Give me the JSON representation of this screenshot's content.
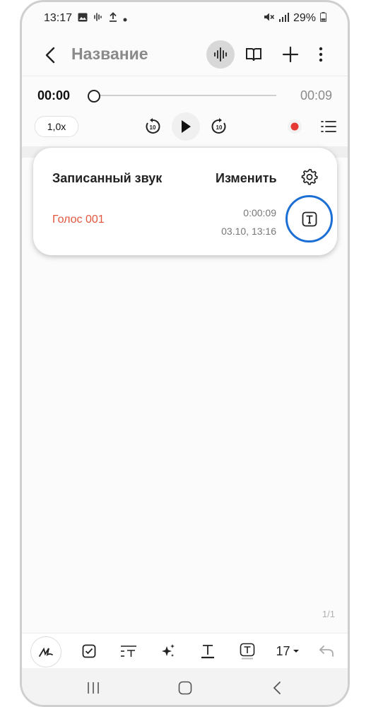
{
  "status": {
    "time": "13:17",
    "battery": "29%"
  },
  "appbar": {
    "title": "Название"
  },
  "player": {
    "current_time": "00:00",
    "total_time": "00:09",
    "progress": 0,
    "speed": "1,0x",
    "rewind_seconds": "10",
    "forward_seconds": "10"
  },
  "card": {
    "title": "Записанный звук",
    "edit_label": "Изменить",
    "recording": {
      "name": "Голос 001",
      "duration": "0:00:09",
      "date": "03.10, 13:16"
    }
  },
  "page_counter": "1/1",
  "toolbar": {
    "font_size": "17"
  },
  "colors": {
    "accent_red": "#e2573e",
    "highlight_blue": "#1c6fd4",
    "record_dot": "#e53935"
  }
}
